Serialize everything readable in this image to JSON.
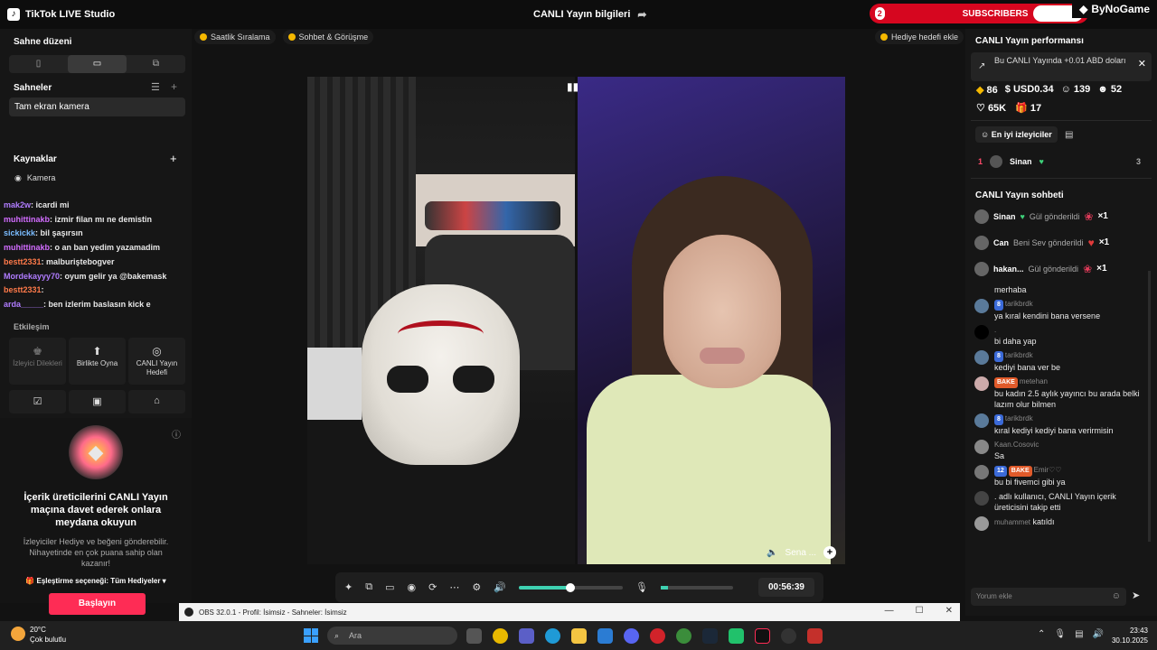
{
  "app": {
    "title": "TikTok LIVE Studio",
    "center_title": "CANLI Yayın bilgileri"
  },
  "overlay": {
    "sub_count": "2",
    "sub_label": "SUBSCRIBERS",
    "sub_right": "5",
    "brand": "ByNoGame"
  },
  "left": {
    "scene_layout_title": "Sahne düzeni",
    "scenes_title": "Sahneler",
    "scene_item": "Tam ekran kamera",
    "sources_title": "Kaynaklar",
    "source_item": "Kamera",
    "chat_overlay": [
      {
        "user": "mak2w",
        "text": ": icardi mi"
      },
      {
        "user": "muhittinakb",
        "text": ": izmir filan mı ne demistin"
      },
      {
        "user": "sickickk",
        "text": ": bil şaşırsın"
      },
      {
        "user": "muhittinakb",
        "text": ": o an ban yedim yazamadim"
      },
      {
        "user": "bestt2331",
        "text": ": malburiştebogver"
      },
      {
        "user": "Mordekayyy70",
        "text": ": oyum gelir ya @bakemask"
      },
      {
        "user": "bestt2331",
        "text": ":"
      },
      {
        "user": "arda_____",
        "text": ": ben izlerim baslasın kick e"
      }
    ],
    "engagement_title": "Etkileşim",
    "engagement": [
      {
        "label": "İzleyici Dilekleri",
        "icon": "♚"
      },
      {
        "label": "Birlikte Oyna",
        "icon": "⬆"
      },
      {
        "label": "CANLI Yayın Hedefi",
        "icon": "◎"
      }
    ],
    "promo_title": "İçerik üreticilerini CANLI Yayın maçına davet ederek onlara meydana okuyun",
    "promo_desc": "İzleyiciler Hediye ve beğeni gönderebilir. Nihayetinde en çok puana sahip olan kazanır!",
    "promo_match": "Eşleştirme seçeneği: Tüm Hediyeler",
    "start_button": "Başlayın"
  },
  "center": {
    "tab1": "Saatlik Sıralama",
    "tab2": "Sohbet & Görüşme",
    "gift_goal": "Hediye hedefi ekle",
    "guest_name": "Sena ...",
    "timer": "00:56:39",
    "volume_level": 0.5
  },
  "right": {
    "perf_title": "CANLI Yayın performansı",
    "notice": "Bu CANLI Yayında +0.01 ABD doları",
    "stats": {
      "diamonds": "86",
      "usd": "USD0.34",
      "viewers": "139",
      "new_followers": "52",
      "likes": "65K",
      "gifters": "17"
    },
    "top_viewers_button": "En iyi izleyiciler",
    "top_viewer": {
      "rank": "1",
      "name": "Sinan",
      "score": "3"
    },
    "live_chat_title": "CANLI Yayın sohbeti",
    "gifts": [
      {
        "name": "Sinan",
        "action": "Gül gönderildi",
        "count": "×1"
      },
      {
        "name": "Can",
        "action": "Beni Sev gönderildi",
        "count": "×1"
      },
      {
        "name": "hakan...",
        "action": "Gül gönderildi",
        "count": "×1"
      }
    ],
    "messages": [
      {
        "level": "",
        "fan": "",
        "user": "",
        "text": "merhaba"
      },
      {
        "level": "8",
        "fan": "",
        "user": "tarikbrdk",
        "text": "ya kıral kendini bana versene"
      },
      {
        "level": "",
        "fan": "",
        "user": ".",
        "text": "bi daha yap"
      },
      {
        "level": "8",
        "fan": "",
        "user": "tarikbrdk",
        "text": "kediyi bana ver be"
      },
      {
        "level": "",
        "fan": "BAKE",
        "user": "metehan",
        "text": "bu kadın 2.5 aylık yayıncı bu arada belki lazım olur bilmen"
      },
      {
        "level": "8",
        "fan": "",
        "user": "tarikbrdk",
        "text": "kıral kediyi kediyi bana verirmisin"
      },
      {
        "level": "",
        "fan": "",
        "user": "Kaan.Cosovic",
        "text": "Sa"
      },
      {
        "level": "12",
        "fan": "BAKE",
        "user": "Emir♡♡",
        "text": "bu bi fivemci gibi ya"
      },
      {
        "level": "",
        "fan": "",
        "user": ".",
        "text": "adlı kullanıcı, CANLI Yayın içerik üreticisini takip etti"
      },
      {
        "level": "",
        "fan": "",
        "user": "muhammet",
        "text": "katıldı"
      }
    ],
    "comment_placeholder": "Yorum ekle"
  },
  "obs": {
    "title": "OBS 32.0.1 - Profil: İsimsiz - Sahneler: İsimsiz"
  },
  "taskbar": {
    "weather_temp": "20°C",
    "weather_desc": "Çok bulutlu",
    "search_placeholder": "Ara",
    "time": "23:43",
    "date": "30.10.2025"
  }
}
